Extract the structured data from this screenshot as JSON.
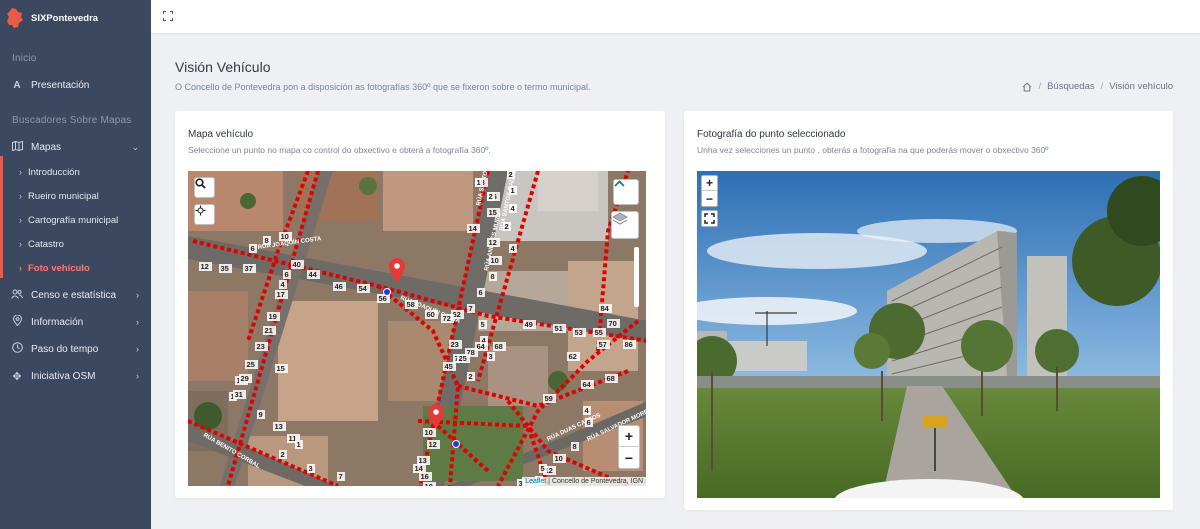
{
  "brand": {
    "name": "SIXPontevedra",
    "logo": "pontevedra-map-logo",
    "accent": "#e85b48"
  },
  "sidebar": {
    "section_inicio": "Inicio",
    "presentacion": "Presentación",
    "section_buscadores": "Buscadores Sobre Mapas",
    "mapas": "Mapas",
    "sub": [
      "Introducción",
      "Rueiro municipal",
      "Cartografía municipal",
      "Catastro",
      "Foto vehículo"
    ],
    "censo": "Censo e estatística",
    "informacion": "Información",
    "paso": "Paso do tempo",
    "osm": "Iniciativa OSM"
  },
  "page": {
    "title": "Visión Vehículo",
    "subtitle": "O Concello de Pontevedra pon a disposición as fotografías 360º que se fixeron sobre o termo municipal."
  },
  "breadcrumb": {
    "busquedas": "Búsquedas",
    "current": "Visión vehículo"
  },
  "map_card": {
    "title": "Mapa vehículo",
    "subtitle": "Seleccione un punto no mapa co control do obxectivo e obterá a fotografía 360º.",
    "zoom_in": "+",
    "zoom_out": "−",
    "attribution_leaflet": "Leaflet",
    "attribution_rest": " | Concello de Pontevedra, IGN",
    "street_labels": [
      "RÚA JOAQUÍN COSTA",
      "RÚA JOAQUÍN COSTA",
      "RÚA SANTOS GALLEGOS",
      "RÚA ANDRÉS MUR",
      "RÚA SANTOS GALLEGOS",
      "RÚA BENITO CORBAL",
      "RÚA DUAS CANTOS",
      "RÚA SALVADOR MORENO"
    ],
    "house_numbers": [
      "18",
      "16",
      "15",
      "14",
      "12",
      "10",
      "8",
      "6",
      "7",
      "5",
      "4",
      "3",
      "2",
      "1",
      "4",
      "2",
      "4",
      "6",
      "8",
      "10",
      "12",
      "35",
      "37",
      "40",
      "44",
      "46",
      "54",
      "56",
      "58",
      "60",
      "62",
      "64",
      "68",
      "72",
      "74",
      "78",
      "45",
      "49",
      "51",
      "53",
      "55",
      "57",
      "59",
      "62",
      "64",
      "68",
      "70",
      "84",
      "86",
      "15",
      "18",
      "1",
      "9",
      "13",
      "11",
      "1",
      "2",
      "3",
      "7",
      "6",
      "4",
      "17",
      "19",
      "21",
      "23",
      "25",
      "29",
      "31",
      "10",
      "12",
      "13",
      "14",
      "16",
      "19",
      "23",
      "25",
      "2",
      "4",
      "6",
      "8",
      "10",
      "12",
      "7",
      "9",
      "3",
      "5",
      "1",
      "2"
    ]
  },
  "photo_card": {
    "title": "Fotografía do punto seleccionado",
    "subtitle": "Unha vez selecciones un punto , obterás a fotografía na que poderás mover o obxectivo 360º",
    "zoom_in": "+",
    "zoom_out": "−"
  }
}
